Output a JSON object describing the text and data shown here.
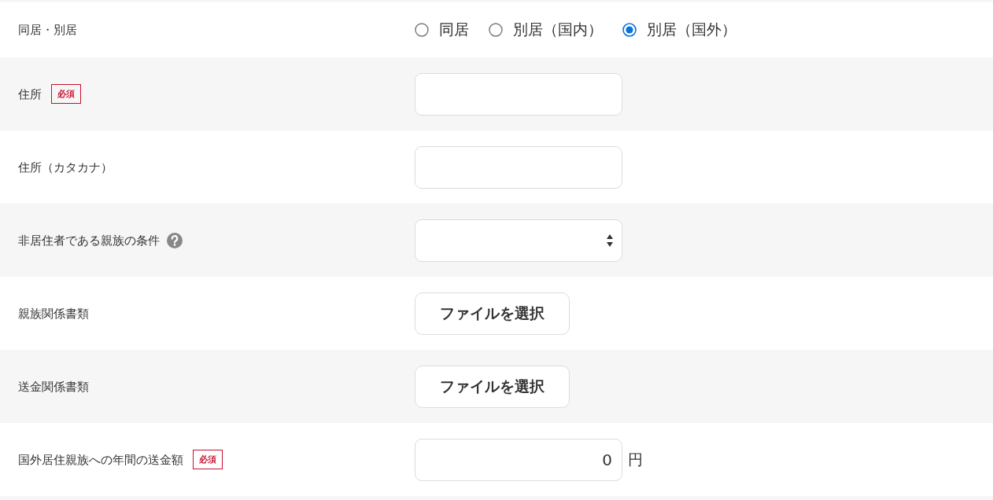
{
  "rows": [
    {
      "kind": "radio",
      "label": "同居・別居",
      "options": [
        {
          "label": "同居",
          "selected": false
        },
        {
          "label": "別居（国内）",
          "selected": false
        },
        {
          "label": "別居（国外）",
          "selected": true
        }
      ]
    },
    {
      "kind": "text",
      "label": "住所",
      "badge": "必須"
    },
    {
      "kind": "text",
      "label": "住所（カタカナ）"
    },
    {
      "kind": "select",
      "label": "非居住者である親族の条件",
      "help": true
    },
    {
      "kind": "file",
      "label": "親族関係書類",
      "button": "ファイルを選択"
    },
    {
      "kind": "file",
      "label": "送金関係書類",
      "button": "ファイルを選択"
    },
    {
      "kind": "amount",
      "label": "国外居住親族への年間の送金額",
      "badge": "必須",
      "value": "0",
      "unit": "円"
    }
  ]
}
